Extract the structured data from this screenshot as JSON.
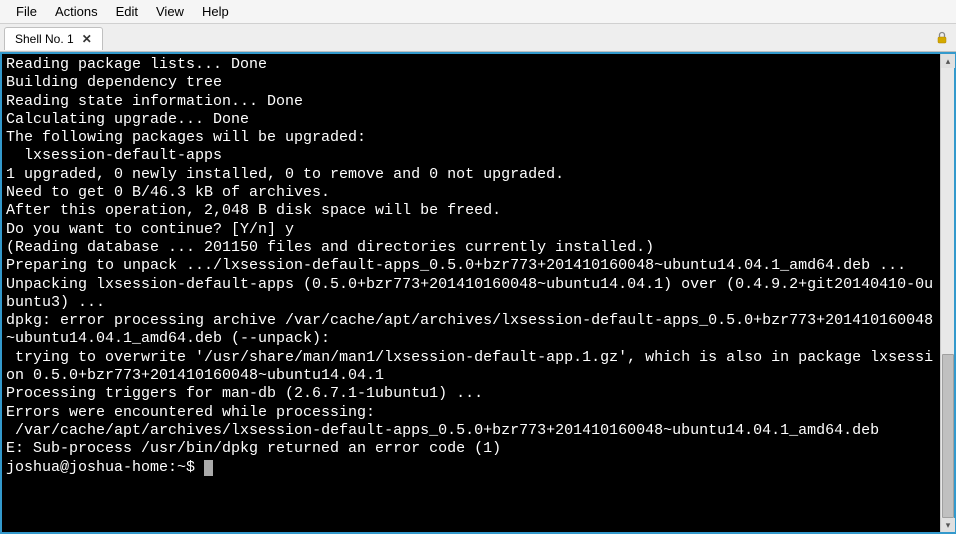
{
  "menu": {
    "items": [
      "File",
      "Actions",
      "Edit",
      "View",
      "Help"
    ]
  },
  "tab": {
    "label": "Shell No. 1",
    "close": "✕"
  },
  "terminal": {
    "lines": [
      "Reading package lists... Done",
      "Building dependency tree",
      "Reading state information... Done",
      "Calculating upgrade... Done",
      "The following packages will be upgraded:",
      "  lxsession-default-apps",
      "1 upgraded, 0 newly installed, 0 to remove and 0 not upgraded.",
      "Need to get 0 B/46.3 kB of archives.",
      "After this operation, 2,048 B disk space will be freed.",
      "Do you want to continue? [Y/n] y",
      "(Reading database ... 201150 files and directories currently installed.)",
      "Preparing to unpack .../lxsession-default-apps_0.5.0+bzr773+201410160048~ubuntu14.04.1_amd64.deb ...",
      "Unpacking lxsession-default-apps (0.5.0+bzr773+201410160048~ubuntu14.04.1) over (0.4.9.2+git20140410-0ubuntu3) ...",
      "dpkg: error processing archive /var/cache/apt/archives/lxsession-default-apps_0.5.0+bzr773+201410160048~ubuntu14.04.1_amd64.deb (--unpack):",
      " trying to overwrite '/usr/share/man/man1/lxsession-default-app.1.gz', which is also in package lxsession 0.5.0+bzr773+201410160048~ubuntu14.04.1",
      "Processing triggers for man-db (2.6.7.1-1ubuntu1) ...",
      "Errors were encountered while processing:",
      " /var/cache/apt/archives/lxsession-default-apps_0.5.0+bzr773+201410160048~ubuntu14.04.1_amd64.deb",
      "E: Sub-process /usr/bin/dpkg returned an error code (1)"
    ],
    "prompt": "joshua@joshua-home:~$ "
  }
}
